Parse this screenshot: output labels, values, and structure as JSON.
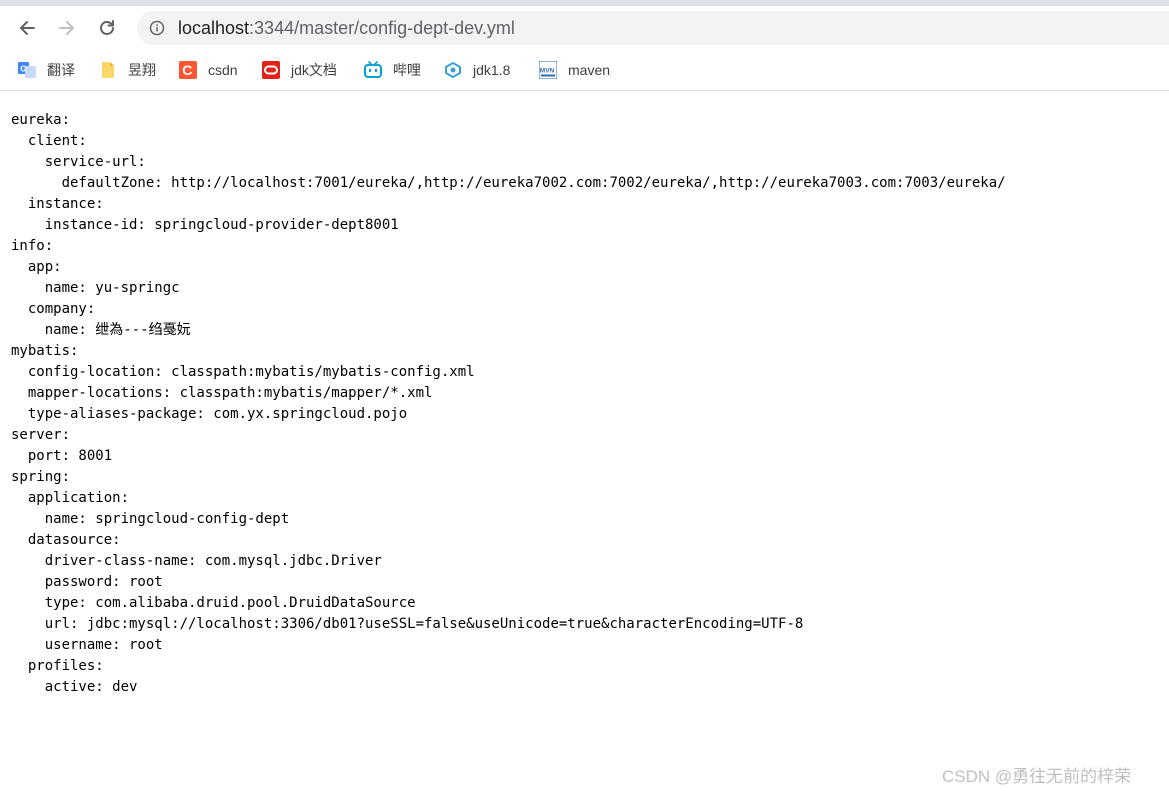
{
  "browser": {
    "address_bar": {
      "host": "localhost",
      "path": ":3344/master/config-dept-dev.yml"
    },
    "bookmarks": [
      {
        "label": "翻译",
        "icon": "translate-icon"
      },
      {
        "label": "昱翔",
        "icon": "folder-icon"
      },
      {
        "label": "csdn",
        "icon": "csdn-icon"
      },
      {
        "label": "jdk文档",
        "icon": "oracle-icon"
      },
      {
        "label": "哔哩",
        "icon": "bilibili-icon"
      },
      {
        "label": "jdk1.8",
        "icon": "jdk-icon"
      },
      {
        "label": "maven",
        "icon": "maven-icon"
      }
    ]
  },
  "yaml_lines": [
    "eureka:",
    "  client:",
    "    service-url:",
    "      defaultZone: http://localhost:7001/eureka/,http://eureka7002.com:7002/eureka/,http://eureka7003.com:7003/eureka/",
    "  instance:",
    "    instance-id: springcloud-provider-dept8001",
    "info:",
    "  app:",
    "    name: yu-springc",
    "  company:",
    "    name: 绁為---绉戞妧",
    "mybatis:",
    "  config-location: classpath:mybatis/mybatis-config.xml",
    "  mapper-locations: classpath:mybatis/mapper/*.xml",
    "  type-aliases-package: com.yx.springcloud.pojo",
    "server:",
    "  port: 8001",
    "spring:",
    "  application:",
    "    name: springcloud-config-dept",
    "  datasource:",
    "    driver-class-name: com.mysql.jdbc.Driver",
    "    password: root",
    "    type: com.alibaba.druid.pool.DruidDataSource",
    "    url: jdbc:mysql://localhost:3306/db01?useSSL=false&useUnicode=true&characterEncoding=UTF-8",
    "    username: root",
    "  profiles:",
    "    active: dev"
  ],
  "watermark": "CSDN @勇往无前的梓荣",
  "colors": {
    "toolbar_bg": "#ffffff",
    "omnibox_bg": "#f1f3f4",
    "icon_gray": "#5f6368",
    "csdn_red": "#fc5531",
    "oracle_red": "#e2231a",
    "bilibili_blue": "#00a1d6",
    "maven_blue": "#2a6ebb"
  }
}
